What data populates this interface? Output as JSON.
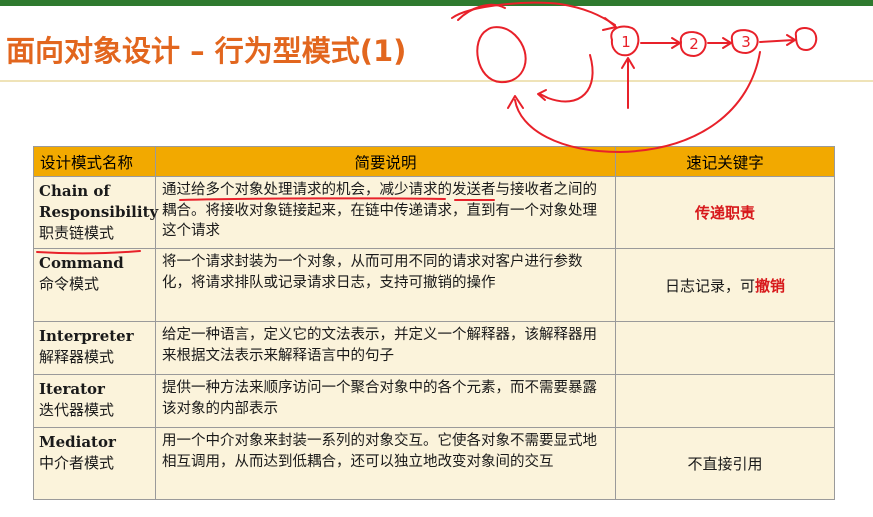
{
  "slide": {
    "title": "面向对象设计 – 行为型模式(1)",
    "accent_color": "#e2661e",
    "header_color": "#f2a900",
    "row_color": "#fbf3db"
  },
  "table": {
    "headers": [
      "设计模式名称",
      "简要说明",
      "速记关键字"
    ],
    "rows": [
      {
        "name_en": "Chain of Responsibility",
        "name_cn": "职责链模式",
        "desc": "通过给多个对象处理请求的机会，减少请求的发送者与接收者之间的耦合。将接收对象链接起来，在链中传递请求，直到有一个对象处理这个请求",
        "kw_plain": "",
        "kw_red": "传递职责"
      },
      {
        "name_en": "Command",
        "name_cn": "命令模式",
        "desc": "将一个请求封装为一个对象，从而可用不同的请求对客户进行参数化，将请求排队或记录请求日志，支持可撤销的操作",
        "kw_plain": "日志记录，可",
        "kw_red": "撤销"
      },
      {
        "name_en": "Interpreter",
        "name_cn": "解释器模式",
        "desc": "给定一种语言，定义它的文法表示，并定义一个解释器，该解释器用来根据文法表示来解释语言中的句子",
        "kw_plain": "",
        "kw_red": ""
      },
      {
        "name_en": "Iterator",
        "name_cn": "迭代器模式",
        "desc": "提供一种方法来顺序访问一个聚合对象中的各个元素，而不需要暴露该对象的内部表示",
        "kw_plain": "",
        "kw_red": ""
      },
      {
        "name_en": "Mediator",
        "name_cn": "中介者模式",
        "desc": "用一个中介对象来封装一系列的对象交互。它使各对象不需要显式地相互调用，从而达到低耦合，还可以独立地改变对象间的交互",
        "kw_plain": "不直接引用",
        "kw_red": ""
      }
    ]
  },
  "annotations": {
    "ink_color": "#e8212a",
    "node_labels": [
      "1",
      "2",
      "3"
    ]
  }
}
